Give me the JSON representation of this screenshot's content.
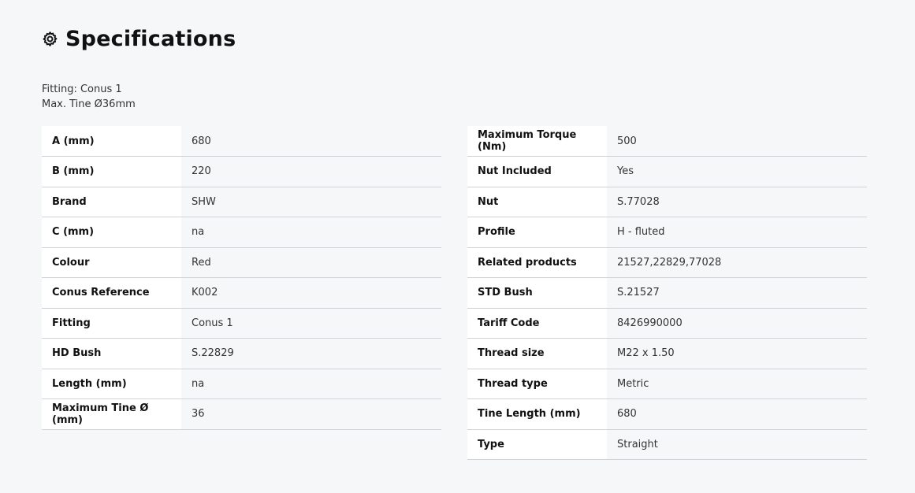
{
  "section": {
    "title": "Specifications",
    "icon": "gear-icon"
  },
  "intro": {
    "line1": "Fitting: Conus 1",
    "line2": "Max. Tine Ø36mm"
  },
  "specs_left": [
    {
      "label": "A (mm)",
      "value": "680"
    },
    {
      "label": "B (mm)",
      "value": "220"
    },
    {
      "label": "Brand",
      "value": "SHW"
    },
    {
      "label": "C (mm)",
      "value": "na"
    },
    {
      "label": "Colour",
      "value": "Red"
    },
    {
      "label": "Conus Reference",
      "value": "K002"
    },
    {
      "label": "Fitting",
      "value": "Conus 1"
    },
    {
      "label": "HD Bush",
      "value": "S.22829"
    },
    {
      "label": "Length (mm)",
      "value": "na"
    },
    {
      "label": "Maximum Tine Ø (mm)",
      "value": "36"
    }
  ],
  "specs_right": [
    {
      "label": "Maximum Torque (Nm)",
      "value": "500"
    },
    {
      "label": "Nut Included",
      "value": "Yes"
    },
    {
      "label": "Nut",
      "value": "S.77028"
    },
    {
      "label": "Profile",
      "value": "H - fluted"
    },
    {
      "label": "Related products",
      "value": "21527,22829,77028"
    },
    {
      "label": "STD Bush",
      "value": "S.21527"
    },
    {
      "label": "Tariff Code",
      "value": "8426990000"
    },
    {
      "label": "Thread size",
      "value": "M22 x 1.50"
    },
    {
      "label": "Thread type",
      "value": "Metric"
    },
    {
      "label": "Tine Length (mm)",
      "value": "680"
    },
    {
      "label": "Type",
      "value": "Straight"
    }
  ],
  "colors": {
    "background": "#f6f7f9",
    "key_cell": "#ffffff",
    "divider": "#cfd2d6"
  }
}
